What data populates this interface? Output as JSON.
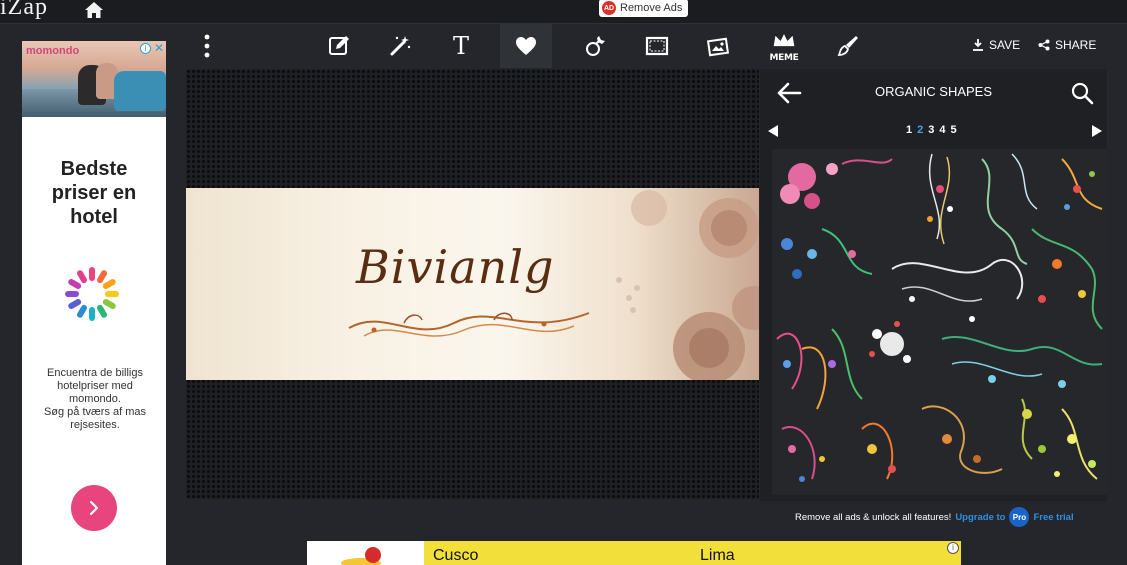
{
  "app": {
    "logo": "iZap",
    "remove_ads_badge": "AD",
    "remove_ads_label": "Remove Ads"
  },
  "left_ad": {
    "brand": "momondo",
    "info_glyph": "i",
    "close_glyph": "✕",
    "heading": "Bedste\npriser en\nhotel",
    "body": "Encuentra de billigs\nhotelpriser med\nmomondo.\nSøg på tværs af mas\nrejsesites.",
    "cta_icon": "chevron-right-icon",
    "accent": "#e8447d"
  },
  "toolbar": {
    "tools": [
      {
        "name": "more-icon"
      },
      {
        "name": "edit-icon"
      },
      {
        "name": "magic-wand-icon"
      },
      {
        "name": "text-icon",
        "glyph": "T"
      },
      {
        "name": "heart-icon",
        "active": true
      },
      {
        "name": "sticker-icon"
      },
      {
        "name": "frame-icon"
      },
      {
        "name": "image-icon"
      },
      {
        "name": "meme-icon",
        "glyph": "MEME"
      },
      {
        "name": "brush-icon"
      }
    ],
    "save_label": "SAVE",
    "share_label": "SHARE"
  },
  "canvas": {
    "banner_text": "Bivianlg"
  },
  "panel": {
    "title": "ORGANIC SHAPES",
    "pages": [
      "1",
      "2",
      "3",
      "4",
      "5"
    ],
    "current_page": "2"
  },
  "upgrade": {
    "text": "Remove all ads & unlock all features!",
    "link": "Upgrade to",
    "badge": "Pro",
    "trial": "Free trial"
  },
  "bottom_ad": {
    "city_1": "Cusco",
    "city_2": "Lima",
    "info_glyph": "i"
  }
}
